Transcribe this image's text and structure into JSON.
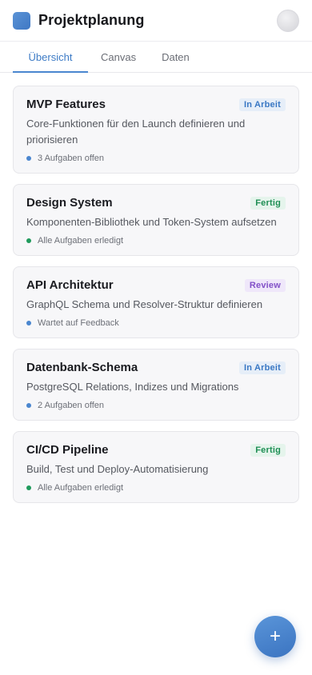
{
  "app": {
    "title": "Projektplanung"
  },
  "tabs": [
    {
      "label": "Übersicht",
      "active": true
    },
    {
      "label": "Canvas",
      "active": false
    },
    {
      "label": "Daten",
      "active": false
    }
  ],
  "cards": [
    {
      "title": "MVP Features",
      "badge": "In Arbeit",
      "badge_color": "#3a78c4",
      "badge_bg": "#e6eef8",
      "description": "Core-Funktionen für den Launch definieren und priorisieren",
      "status": "3 Aufgaben offen",
      "dot_color": "#4a86cf"
    },
    {
      "title": "Design System",
      "badge": "Fertig",
      "badge_color": "#1f8f55",
      "badge_bg": "#e5f4ec",
      "description": "Komponenten-Bibliothek und Token-System aufsetzen",
      "status": "Alle Aufgaben erledigt",
      "dot_color": "#1f9a5c"
    },
    {
      "title": "API Architektur",
      "badge": "Review",
      "badge_color": "#8250c8",
      "badge_bg": "#efe7fa",
      "description": "GraphQL Schema und Resolver-Struktur definieren",
      "status": "Wartet auf Feedback",
      "dot_color": "#4a86cf"
    },
    {
      "title": "Datenbank-Schema",
      "badge": "In Arbeit",
      "badge_color": "#3a78c4",
      "badge_bg": "#e6eef8",
      "description": "PostgreSQL Relations, Indizes und Migrations",
      "status": "2 Aufgaben offen",
      "dot_color": "#4a86cf"
    },
    {
      "title": "CI/CD Pipeline",
      "badge": "Fertig",
      "badge_color": "#1f8f55",
      "badge_bg": "#e5f4ec",
      "description": "Build, Test und Deploy-Automatisierung",
      "status": "Alle Aufgaben erledigt",
      "dot_color": "#1f9a5c"
    }
  ],
  "fab": {
    "label": "+"
  }
}
